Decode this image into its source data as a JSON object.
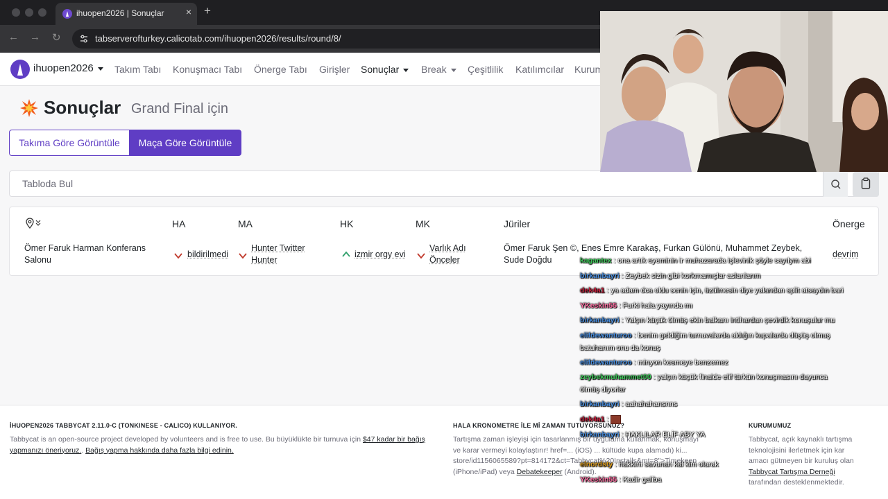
{
  "browser": {
    "tab_title": "ihuopen2026 | Sonuçlar",
    "close_glyph": "×",
    "new_tab_glyph": "+",
    "back_glyph": "←",
    "forward_glyph": "→",
    "reload_glyph": "↻",
    "url": "tabserverofturkey.calicotab.com/ihuopen2026/results/round/8/"
  },
  "navbar": {
    "brand": "ihuopen2026",
    "items": [
      {
        "label": "Takım Tabı"
      },
      {
        "label": "Konuşmacı Tabı"
      },
      {
        "label": "Önerge Tabı"
      },
      {
        "label": "Girişler"
      },
      {
        "label": "Sonuçlar"
      },
      {
        "label": "Break"
      },
      {
        "label": "Çeşitlilik"
      },
      {
        "label": "Katılımcılar"
      },
      {
        "label": "Kurum"
      }
    ]
  },
  "page": {
    "title": "Sonuçlar",
    "subtitle": "Grand Final için",
    "view_by_team": "Takıma Göre Görüntüle",
    "view_by_match": "Maça Göre Görüntüle"
  },
  "search": {
    "placeholder": "Tabloda Bul"
  },
  "table": {
    "headers": {
      "ha": "HA",
      "ma": "MA",
      "hk": "HK",
      "mk": "MK",
      "juries": "Jüriler",
      "motion": "Önerge"
    },
    "rows": [
      {
        "venue_line1": "Ömer Faruk Harman Konferans",
        "venue_line2": "Salonu",
        "ha": "bildirilmedi",
        "ma_line1": "Hunter Twitter",
        "ma_line2": "Hunter",
        "hk": "izmir orgy evi",
        "mk_line1": "Varlık Adı",
        "mk_line2": "Önceler",
        "juries_line1": "Ömer Faruk Şen ©, Enes Emre Karakaş, Furkan Gülönü, Muhammet Zeybek,",
        "juries_line2": "Sude Doğdu",
        "motion": "devrim"
      }
    ]
  },
  "footer": {
    "col1_heading": "İHUOPEN2026 TABBYCAT 2.11.0-C (TONKINESE - CALICO) KULLANIYOR.",
    "col1_text_a": "Tabbycat is an open-source project developed by volunteers and is free to use. Bu büyüklükte bir turnuva için ",
    "col1_link_amount": "$47 kadar bir bağış yapmanızı öneriyoruz.",
    "col1_text_b": ". ",
    "col1_link_more": "Bağış yapma hakkında daha fazla bilgi edinin.",
    "col2_heading": "HALA KRONOMETRE İLE Mİ ZAMAN TUTUYORSUNUZ?",
    "col2_line1": "Tartışma zaman işleyişi için tasarlanmış bir uygulama kullanmak, konuşmayı",
    "col2_line2": "ve karar vermeyi kolaylaştırır! href=... (iOS) ... kültüde kupa alamadı) ki...",
    "col2_line3": "store/id1156065589?pt=814172&ct=Tabbycat%20Installs&mt=8\">Timekeep",
    "col2_line4a": "(iPhone/iPad) veya ",
    "col2_link": "Debatekeeper",
    "col2_line4b": " (Android).",
    "col3_heading": "KURUMUMUZ",
    "col3_line1": "Tabbycat, açık kaynaklı tartışma",
    "col3_line2": "teknolojisini ilerletmek için kar",
    "col3_line3": "amacı gütmeyen bir kuruluş olan",
    "col3_link": "Tabbycat Tartışma Derneği",
    "col3_line5": "tarafından desteklenmektedir."
  },
  "chat": [
    {
      "user": "kagantex",
      "text": "ona artık eyeminin ir muhazarada işlevinik şöyle sayılym abi",
      "color": "#3ec95a"
    },
    {
      "user": "birkanbayri",
      "text": "Zeybek sizin gibi korkmamışlar aslanlarım",
      "color": "#4a90e2"
    },
    {
      "user": "dek4a1",
      "text": "ya adam dca oldu senin için, üzülmesin diye yalandan split atsaydın bari",
      "color": "#c41e3a"
    },
    {
      "user": "YKeskin55",
      "text": "Furki hala yayında mı",
      "color": "#ff6fa3"
    },
    {
      "user": "birkanbayri",
      "text": "Yalçın küçük ölmüş ekin balkanı intihardan çevirdik konuşulur mu",
      "color": "#4a90e2"
    },
    {
      "user": "elifdewanturoo",
      "text": "benim geldiğim turnuvalarda aldığın kupalarda düşüş olmuş",
      "text2": "batuhanım onu da konuş",
      "color": "#4a90e2"
    },
    {
      "user": "elifdewanturoo",
      "text": "minyon kesmeye benzemez",
      "color": "#4a90e2"
    },
    {
      "user": "zeybekmuhammet00",
      "text": "yalçın küçük finalde elif türkün konuşmasını duyunca",
      "text2": "ölmüş diyorlar",
      "color": "#3ec95a"
    },
    {
      "user": "birkanbayri",
      "text": "aahahahansnns",
      "color": "#4a90e2"
    },
    {
      "user": "dek4a1",
      "text": "",
      "color": "#c41e3a"
    },
    {
      "user": "birkanbayri",
      "text": "HAKLILAR ELİF ABY YA",
      "color": "#4a90e2"
    },
    {
      "user": "elnordsty",
      "text": "hakkını savunan kal kim olarak",
      "color": "#e0a020"
    },
    {
      "user": "YKeskin55",
      "text": "Kadir galiba",
      "color": "#ff6fa3"
    }
  ],
  "colors": {
    "accent": "#5f3dc4",
    "loss": "#c0392b",
    "win": "#2e9e6a"
  }
}
